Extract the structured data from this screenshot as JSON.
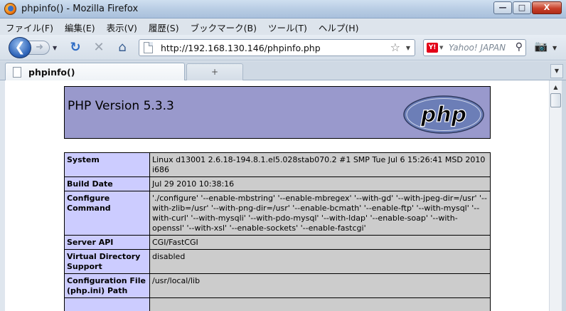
{
  "window": {
    "title": "phpinfo() - Mozilla Firefox",
    "buttons": {
      "minimize": "—",
      "maximize": "□",
      "close": "X"
    }
  },
  "menu": [
    "ファイル(F)",
    "編集(E)",
    "表示(V)",
    "履歴(S)",
    "ブックマーク(B)",
    "ツール(T)",
    "ヘルプ(H)"
  ],
  "nav": {
    "url": "http://192.168.130.146/phpinfo.php",
    "search_placeholder": "Yahoo! JAPAN",
    "search_engine_badge": "Y!"
  },
  "tabs": [
    {
      "label": "phpinfo()"
    }
  ],
  "new_tab_label": "+",
  "php": {
    "version_title": "PHP Version 5.3.3",
    "logo_text": "php"
  },
  "info_rows": [
    {
      "key": "System",
      "value": "Linux d13001                    2.6.18-194.8.1.el5.028stab070.2 #1 SMP Tue Jul 6 15:26:41 MSD 2010 i686"
    },
    {
      "key": "Build Date",
      "value": "Jul 29 2010 10:38:16"
    },
    {
      "key": "Configure Command",
      "value": "'./configure' '--enable-mbstring' '--enable-mbregex' '--with-gd' '--with-jpeg-dir=/usr' '--with-zlib=/usr' '--with-png-dir=/usr' '--enable-bcmath' '--enable-ftp' '--with-mysql' '--with-curl' '--with-mysqli' '--with-pdo-mysql' '--with-ldap' '--enable-soap' '--with-openssl' '--with-xsl' '--enable-sockets' '--enable-fastcgi'"
    },
    {
      "key": "Server API",
      "value": "CGI/FastCGI"
    },
    {
      "key": "Virtual Directory Support",
      "value": "disabled"
    },
    {
      "key": "Configuration File (php.ini) Path",
      "value": "/usr/local/lib"
    },
    {
      "key": "",
      "value": ""
    }
  ]
}
